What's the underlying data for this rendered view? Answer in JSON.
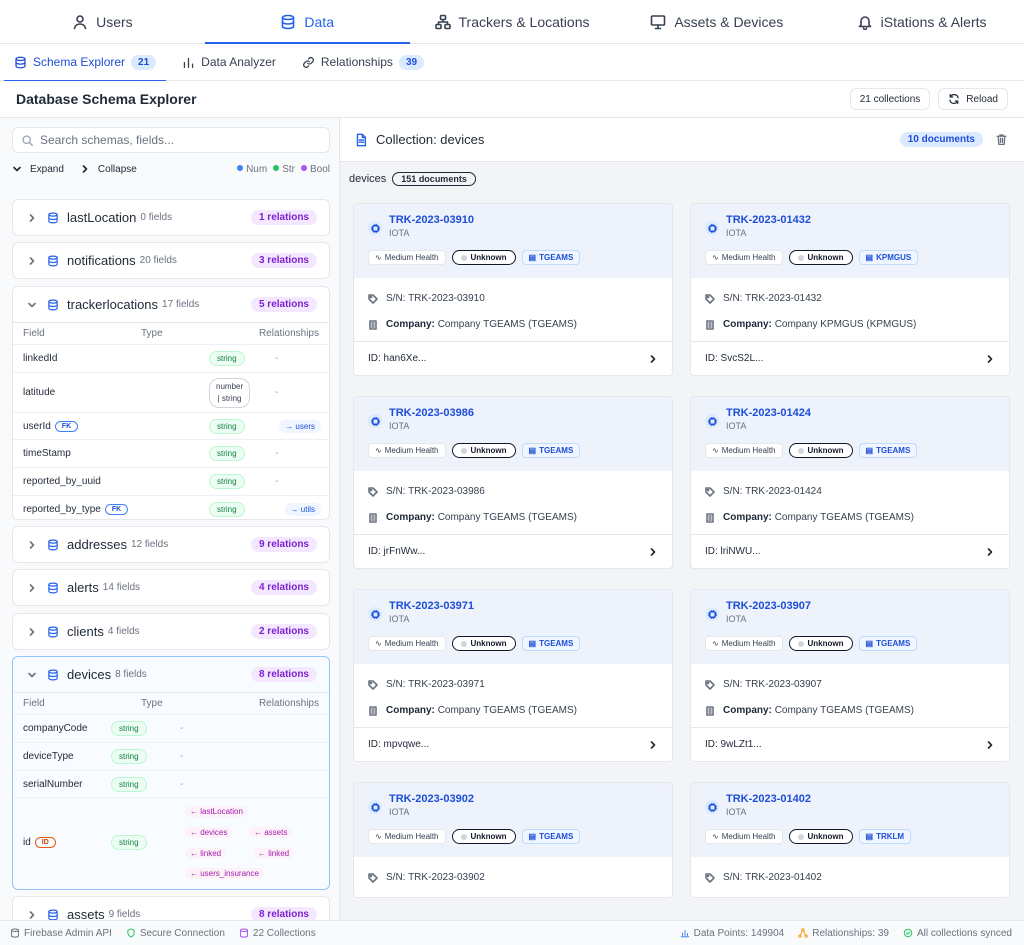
{
  "nav": {
    "tabs": [
      {
        "label": "Users"
      },
      {
        "label": "Data"
      },
      {
        "label": "Trackers & Locations"
      },
      {
        "label": "Assets & Devices"
      },
      {
        "label": "iStations & Alerts"
      }
    ],
    "active": "Data"
  },
  "subnav": {
    "tabs": [
      {
        "label": "Schema Explorer",
        "count": "21"
      },
      {
        "label": "Data Analyzer"
      },
      {
        "label": "Relationships",
        "count": "39"
      }
    ]
  },
  "header": {
    "title": "Database Schema Explorer",
    "collections_label": "21 collections",
    "reload_label": "Reload"
  },
  "sidebar": {
    "search_placeholder": "Search schemas, fields...",
    "expand_label": "Expand",
    "collapse_label": "Collapse",
    "legend": [
      {
        "label": "Num",
        "color": "#3b82f6"
      },
      {
        "label": "Str",
        "color": "#22c55e"
      },
      {
        "label": "Bool",
        "color": "#a855f7"
      }
    ],
    "table_headers": {
      "field": "Field",
      "type": "Type",
      "relationships": "Relationships"
    },
    "collections": [
      {
        "name": "lastLocation",
        "fields": "0 fields",
        "relations": "1 relations"
      },
      {
        "name": "notifications",
        "fields": "20 fields",
        "relations": "3 relations"
      },
      {
        "name": "trackerlocations",
        "fields": "17 fields",
        "relations": "5 relations",
        "rows": [
          {
            "field": "linkedId",
            "type": "string",
            "rel": "-"
          },
          {
            "field": "latitude",
            "type_line1": "number",
            "type_line2": "| string",
            "rel": "-"
          },
          {
            "field": "userId",
            "badge": "FK",
            "type": "string",
            "rel": "→ users"
          },
          {
            "field": "timeStamp",
            "type": "string",
            "rel": "-"
          },
          {
            "field": "reported_by_uuid",
            "type": "string",
            "rel": "-"
          },
          {
            "field": "reported_by_type",
            "badge": "FK",
            "type": "string",
            "rel": "→ utils"
          }
        ]
      },
      {
        "name": "addresses",
        "fields": "12 fields",
        "relations": "9 relations"
      },
      {
        "name": "alerts",
        "fields": "14 fields",
        "relations": "4 relations"
      },
      {
        "name": "clients",
        "fields": "4 fields",
        "relations": "2 relations"
      },
      {
        "name": "devices",
        "fields": "8 fields",
        "relations": "8 relations",
        "rows": [
          {
            "field": "companyCode",
            "type": "string",
            "rel": "-"
          },
          {
            "field": "deviceType",
            "type": "string",
            "rel": "-"
          },
          {
            "field": "serialNumber",
            "type": "string",
            "rel": "-"
          },
          {
            "field": "id",
            "badge": "ID",
            "type": "string",
            "links": [
              "← lastLocation",
              "← devices",
              "← assets",
              "← linked",
              "← linked",
              "← users_insurance"
            ]
          }
        ]
      },
      {
        "name": "assets",
        "fields": "9 fields",
        "relations": "8 relations"
      }
    ]
  },
  "main": {
    "collection_title": "Collection: devices",
    "documents_pill": "10 documents",
    "doc_line_label": "devices",
    "doc_line_count": "151 documents",
    "sn_label": "S/N:",
    "company_label": "Company:",
    "cards": [
      {
        "title": "TRK-2023-03910",
        "sub": "IOTA",
        "health": "Medium Health",
        "status": "Unknown",
        "company": "TGEAMS",
        "sn": "TRK-2023-03910",
        "company_full": "Company TGEAMS (TGEAMS)",
        "id": "ID: han6Xe..."
      },
      {
        "title": "TRK-2023-01432",
        "sub": "IOTA",
        "health": "Medium Health",
        "status": "Unknown",
        "company": "KPMGUS",
        "sn": "TRK-2023-01432",
        "company_full": "Company KPMGUS (KPMGUS)",
        "id": "ID: SvcS2L..."
      },
      {
        "title": "TRK-2023-03986",
        "sub": "IOTA",
        "health": "Medium Health",
        "status": "Unknown",
        "company": "TGEAMS",
        "sn": "TRK-2023-03986",
        "company_full": "Company TGEAMS (TGEAMS)",
        "id": "ID: jrFnWw..."
      },
      {
        "title": "TRK-2023-01424",
        "sub": "IOTA",
        "health": "Medium Health",
        "status": "Unknown",
        "company": "TGEAMS",
        "sn": "TRK-2023-01424",
        "company_full": "Company TGEAMS (TGEAMS)",
        "id": "ID: lriNWU..."
      },
      {
        "title": "TRK-2023-03971",
        "sub": "IOTA",
        "health": "Medium Health",
        "status": "Unknown",
        "company": "TGEAMS",
        "sn": "TRK-2023-03971",
        "company_full": "Company TGEAMS (TGEAMS)",
        "id": "ID: mpvqwe..."
      },
      {
        "title": "TRK-2023-03907",
        "sub": "IOTA",
        "health": "Medium Health",
        "status": "Unknown",
        "company": "TGEAMS",
        "sn": "TRK-2023-03907",
        "company_full": "Company TGEAMS (TGEAMS)",
        "id": "ID: 9wLZt1..."
      },
      {
        "title": "TRK-2023-03902",
        "sub": "IOTA",
        "health": "Medium Health",
        "status": "Unknown",
        "company": "TGEAMS",
        "sn": "TRK-2023-03902"
      },
      {
        "title": "TRK-2023-01402",
        "sub": "IOTA",
        "health": "Medium Health",
        "status": "Unknown",
        "company": "TRKLM",
        "sn": "TRK-2023-01402"
      }
    ]
  },
  "footer": {
    "api": "Firebase Admin API",
    "secure": "Secure Connection",
    "collections": "22 Collections",
    "data_points": "Data Points: 149904",
    "relationships": "Relationships: 39",
    "synced": "All collections synced"
  }
}
